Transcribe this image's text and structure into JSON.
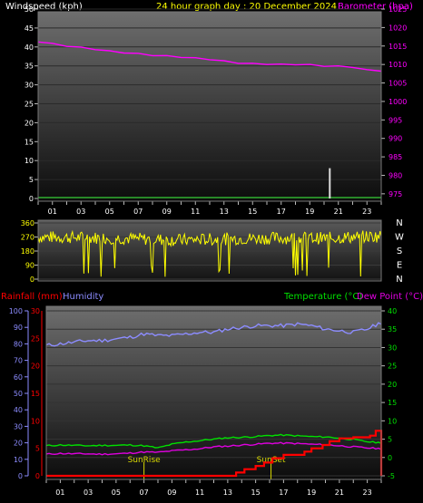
{
  "header": {
    "wind_label": "Windspeed (kph)",
    "title": "24 hour graph day : 20 December 2024",
    "baro_label": "Barometer (hpa)"
  },
  "bottom_header": {
    "rain_label": "Rainfall (mm)",
    "humidity_label": "Humidity",
    "temp_label": "Temperature (°C)",
    "dew_label": "Dew Point (°C)"
  },
  "colors": {
    "wind": "#ffffff",
    "title": "#ffff00",
    "barometer": "#ff00ff",
    "direction": "#ffff00",
    "rainfall": "#ff0000",
    "humidity": "#8c8cff",
    "temperature": "#00e000",
    "dewpoint": "#e000e0",
    "markers": "#d8d800"
  },
  "chart_data": [
    {
      "type": "line",
      "name": "wind-and-barometer",
      "x_ticks": [
        "01",
        "03",
        "05",
        "07",
        "09",
        "11",
        "13",
        "15",
        "17",
        "19",
        "21",
        "23"
      ],
      "y_left": {
        "label": "Windspeed (kph)",
        "ticks": [
          0,
          5,
          10,
          15,
          20,
          25,
          30,
          35,
          40,
          45,
          50
        ],
        "ylim": [
          0,
          50
        ]
      },
      "y_right": {
        "label": "Barometer (hpa)",
        "ticks": [
          975,
          980,
          985,
          990,
          995,
          1000,
          1005,
          1010,
          1015,
          1020,
          1025
        ],
        "ylim": [
          973,
          1025
        ]
      },
      "xlim": [
        0,
        24
      ],
      "wind": {
        "values": [],
        "gust_spikes": [
          {
            "x": 20.4,
            "y": 8
          }
        ]
      },
      "barometer": {
        "x": [
          0,
          1,
          2,
          3,
          4,
          5,
          6,
          7,
          8,
          9,
          10,
          11,
          12,
          13,
          14,
          15,
          16,
          17,
          18,
          19,
          20,
          21,
          22,
          23,
          24
        ],
        "y": [
          1016.2,
          1015.6,
          1015.0,
          1014.6,
          1014.1,
          1013.6,
          1013.2,
          1012.9,
          1012.5,
          1012.3,
          1012.0,
          1011.7,
          1011.4,
          1010.9,
          1010.4,
          1010.2,
          1010.1,
          1010.0,
          1010.0,
          1009.9,
          1009.6,
          1009.5,
          1009.3,
          1008.5,
          1008.3
        ]
      }
    },
    {
      "type": "scatter",
      "name": "wind-direction",
      "y_ticks": [
        0,
        90,
        180,
        270,
        360
      ],
      "ylim": [
        0,
        360
      ],
      "compass": [
        "N",
        "W",
        "S",
        "E",
        "N"
      ],
      "series": [
        {
          "x": [
            0,
            2,
            4,
            6,
            8,
            10,
            12,
            14,
            16,
            18,
            20,
            22,
            24
          ],
          "y": [
            270,
            268,
            265,
            262,
            255,
            250,
            255,
            260,
            262,
            265,
            262,
            270,
            275
          ]
        }
      ]
    },
    {
      "type": "line",
      "name": "rain-humidity-temperature",
      "y_left_outer": {
        "label": "Rainfall (mm)",
        "ticks": [
          0,
          5,
          10,
          15,
          20,
          25,
          30
        ],
        "ylim": [
          0,
          30
        ]
      },
      "y_left_inner": {
        "label": "Humidity",
        "ticks": [
          0,
          10,
          20,
          30,
          40,
          50,
          60,
          70,
          80,
          90,
          100
        ],
        "ylim": [
          0,
          100
        ]
      },
      "y_right": {
        "label": "Temperature (°C)",
        "ticks": [
          -5,
          0,
          5,
          10,
          15,
          20,
          25,
          30,
          35,
          40
        ],
        "ylim": [
          -5,
          40
        ]
      },
      "x_ticks": [
        "01",
        "03",
        "05",
        "07",
        "09",
        "11",
        "13",
        "15",
        "17",
        "19",
        "21",
        "23"
      ],
      "xlim": [
        0,
        24
      ],
      "annotations": [
        {
          "text": "SunRise",
          "x": 7.0
        },
        {
          "text": "SunSet",
          "x": 16.1
        }
      ],
      "humidity": {
        "x": [
          0,
          1,
          2,
          3,
          4,
          5,
          6,
          7,
          8,
          9,
          10,
          11,
          12,
          13,
          14,
          15,
          16,
          17,
          18,
          19,
          20,
          21,
          22,
          23,
          24
        ],
        "y": [
          79,
          80,
          81,
          82,
          82,
          83,
          84,
          86,
          85,
          85,
          86,
          87,
          87,
          89,
          90,
          91,
          91,
          91,
          92,
          91,
          89,
          88,
          87,
          89,
          93
        ]
      },
      "temperature": {
        "x": [
          0,
          1,
          2,
          3,
          4,
          5,
          6,
          7,
          8,
          9,
          10,
          11,
          12,
          13,
          14,
          15,
          16,
          17,
          18,
          19,
          20,
          21,
          22,
          23,
          24
        ],
        "y": [
          3.2,
          3.4,
          3.3,
          3.2,
          3.3,
          3.3,
          3.4,
          3.2,
          2.6,
          3.6,
          4.2,
          4.6,
          5.0,
          5.4,
          5.5,
          5.7,
          6.0,
          6.1,
          5.9,
          5.7,
          5.6,
          5.3,
          4.9,
          4.3,
          4.0
        ]
      },
      "dewpoint": {
        "x": [
          0,
          1,
          2,
          3,
          4,
          5,
          6,
          7,
          8,
          9,
          10,
          11,
          12,
          13,
          14,
          15,
          16,
          17,
          18,
          19,
          20,
          21,
          22,
          23,
          24
        ],
        "y": [
          0.9,
          1.1,
          1.0,
          1.0,
          0.9,
          1.0,
          1.2,
          1.5,
          1.4,
          1.8,
          2.1,
          2.4,
          2.9,
          3.1,
          3.4,
          3.6,
          3.9,
          3.9,
          3.8,
          3.6,
          3.5,
          3.2,
          2.9,
          2.6,
          2.4
        ]
      },
      "rainfall": {
        "x": [
          0,
          13.0,
          13.6,
          14.2,
          15.0,
          15.6,
          16.2,
          17.0,
          18.5,
          19.0,
          19.8,
          20.3,
          21.0,
          22.0,
          23.2,
          23.6,
          24
        ],
        "y": [
          0,
          0,
          0.6,
          1.2,
          1.8,
          2.4,
          3.2,
          3.8,
          4.4,
          5.0,
          5.6,
          6.3,
          6.8,
          7.0,
          7.3,
          8.2,
          0
        ]
      }
    }
  ]
}
